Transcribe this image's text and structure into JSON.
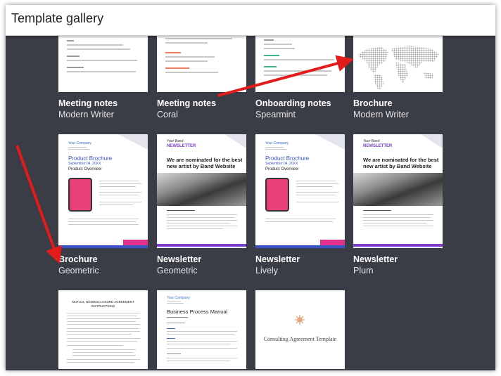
{
  "header": {
    "title": "Template gallery"
  },
  "row1": [
    {
      "name": "Meeting notes",
      "style": "Modern Writer"
    },
    {
      "name": "Meeting notes",
      "style": "Coral"
    },
    {
      "name": "Onboarding notes",
      "style": "Spearmint"
    },
    {
      "name": "Brochure",
      "style": "Modern Writer"
    }
  ],
  "row2": [
    {
      "name": "Brochure",
      "style": "Geometric"
    },
    {
      "name": "Newsletter",
      "style": "Geometric"
    },
    {
      "name": "Newsletter",
      "style": "Lively"
    },
    {
      "name": "Newsletter",
      "style": "Plum"
    }
  ],
  "previews": {
    "company": "Your Company",
    "product_brochure": "Product Brochure",
    "product_overview": "Product Overview",
    "newsletter": "NEWSLETTER",
    "your_band": "Your Band",
    "nominated": "We are nominated for the best new artist by Band Website",
    "business_process_manual": "Business Process Manual",
    "consulting_agreement": "Consulting Agreement Template",
    "mutual_agreement": "MUTUAL NONDISCLOSURE AGREEMENT",
    "instructions": "INSTRUCTIONS"
  },
  "colors": {
    "frame_bg": "#3a3c46",
    "arrow": "#e31b1b",
    "brochure_accent": "#3a55c8",
    "newsletter_accent": "#7a3fc8"
  }
}
